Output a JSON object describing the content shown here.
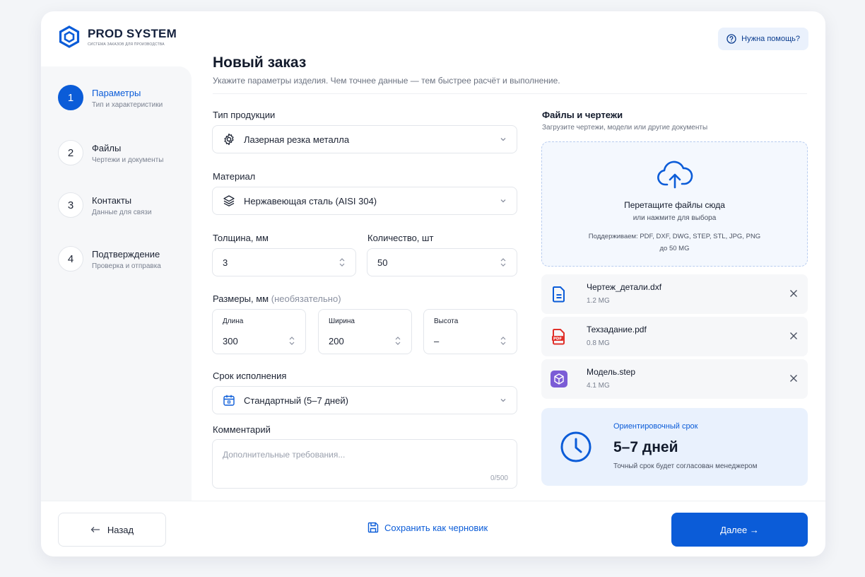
{
  "brand": {
    "name": "PROD SYSTEM",
    "tagline": "СИСТЕМА ЗАКАЗОВ ДЛЯ ПРОИЗВОДСТВА"
  },
  "help": {
    "label": "Нужна помощь?"
  },
  "steps": [
    {
      "num": "1",
      "title": "Параметры",
      "sub": "Тип и характеристики",
      "active": true
    },
    {
      "num": "2",
      "title": "Файлы",
      "sub": "Чертежи и документы"
    },
    {
      "num": "3",
      "title": "Контакты",
      "sub": "Данные для связи"
    },
    {
      "num": "4",
      "title": "Подтверждение",
      "sub": "Проверка и отправка"
    }
  ],
  "header": {
    "title": "Новый заказ",
    "subtitle": "Укажите параметры изделия. Чем точнее данные — тем быстрее расчёт и выполнение."
  },
  "form": {
    "product_type": {
      "label": "Тип продукции",
      "value": "Лазерная резка металла",
      "icon": "gear-icon"
    },
    "material": {
      "label": "Материал",
      "value": "Нержавеющая сталь (AISI 304)",
      "icon": "layers-icon"
    },
    "thickness": {
      "label": "Толщина, мм",
      "value": "3"
    },
    "quantity": {
      "label": "Количество, шт",
      "value": "50"
    },
    "dimensions": {
      "label": "Размеры, мм",
      "optional": "(необязательно)",
      "length": {
        "label": "Длина",
        "value": "300"
      },
      "width": {
        "label": "Ширина",
        "value": "200"
      },
      "height": {
        "label": "Высота",
        "value": "–"
      }
    },
    "deadline": {
      "label": "Срок исполнения",
      "value": "Стандартный (5–7 дней)",
      "icon": "calendar-icon"
    },
    "comment": {
      "label": "Комментарий",
      "placeholder": "Дополнительные требования...",
      "counter": "0/500"
    }
  },
  "files": {
    "title": "Файлы и чертежи",
    "subtitle": "Загрузите чертежи, модели или другие документы",
    "dropzone": {
      "title": "Перетащите файлы сюда",
      "sub": "или нажмите для выбора",
      "formats": "Поддерживаем: PDF, DXF, DWG, STEP, STL, JPG, PNG",
      "limit": "до 50 MG"
    },
    "items": [
      {
        "name": "Чертеж_детали.dxf",
        "size": "1.2 MG",
        "icon": "document-icon"
      },
      {
        "name": "Техзадание.pdf",
        "size": "0.8 MG",
        "icon": "pdf-icon"
      },
      {
        "name": "Модель.step",
        "size": "4.1 MG",
        "icon": "cube-icon"
      }
    ]
  },
  "eta": {
    "caption": "Ориентировочный срок",
    "value": "5–7 дней",
    "note": "Точный срок будет согласован менеджером"
  },
  "footer": {
    "back": "Назад",
    "draft": "Сохранить как черновик",
    "next": "Далее →"
  },
  "colors": {
    "accent": "#0b5cd8",
    "pdf": "#e0302a",
    "step": "#7b5cd6"
  }
}
